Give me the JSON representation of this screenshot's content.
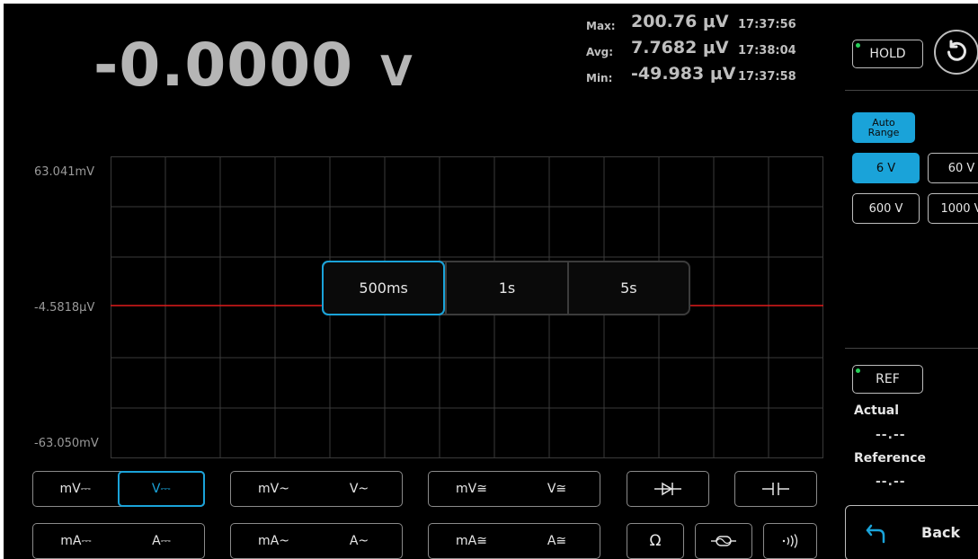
{
  "reading": {
    "value": "-0.0000",
    "unit": "V"
  },
  "stats": [
    {
      "label": "Max:",
      "value": "200.76 μV",
      "time": "17:37:56"
    },
    {
      "label": "Avg:",
      "value": "7.7682 μV",
      "time": "17:38:04"
    },
    {
      "label": "Min:",
      "value": "-49.983 μV",
      "time": "17:37:58"
    }
  ],
  "plot": {
    "y_top_label": "63.041mV",
    "y_mid_label": "-4.5818μV",
    "y_bottom_label": "-63.050mV",
    "trace_color": "#e01b1b",
    "grid_color": "#3a3a3a"
  },
  "timebase": {
    "options": [
      "500ms",
      "1s",
      "5s"
    ],
    "selected": "500ms"
  },
  "controls": {
    "hold_label": "HOLD",
    "auto_range_label": "Auto Range",
    "ranges": [
      "6 V",
      "60 V",
      "600 V",
      "1000 V"
    ],
    "selected_range": "6 V",
    "ref_label": "REF",
    "actual_label": "Actual",
    "actual_value": "--.--",
    "reference_label": "Reference",
    "reference_value": "--.--",
    "back_label": "Back"
  },
  "modes": {
    "dc_voltage": [
      "mV⎓",
      "V⎓"
    ],
    "ac_voltage": [
      "mV~",
      "V~"
    ],
    "acdc_voltage": [
      "mV≅",
      "V≅"
    ],
    "dc_current": [
      "mA⎓",
      "A⎓"
    ],
    "ac_current": [
      "mA~",
      "A~"
    ],
    "acdc_current": [
      "mA≅",
      "A≅"
    ],
    "resistance": "Ω",
    "selected": "V⎓"
  },
  "accent_color": "#1aa3d9",
  "led_color": "#28d05a"
}
